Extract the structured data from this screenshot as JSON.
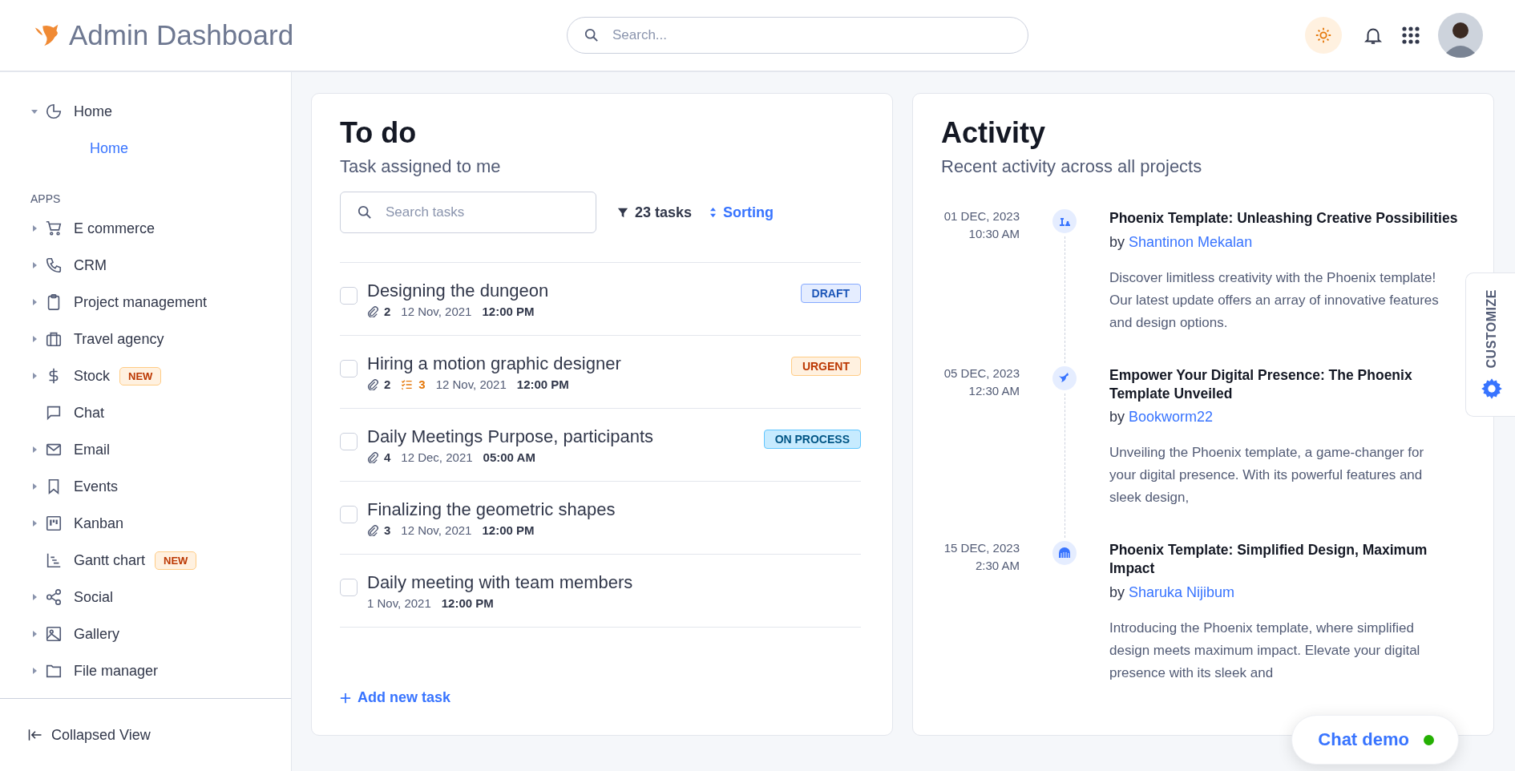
{
  "header": {
    "title": "Admin Dashboard",
    "search": {
      "placeholder": "Search..."
    }
  },
  "sidebar": {
    "groups": [
      {
        "label": "Home",
        "expanded": true,
        "children": [
          {
            "label": "Home",
            "selected": true
          }
        ]
      }
    ],
    "section_label": "APPS",
    "items": [
      {
        "label": "E commerce",
        "expandable": true
      },
      {
        "label": "CRM",
        "expandable": true
      },
      {
        "label": "Project management",
        "expandable": true
      },
      {
        "label": "Travel agency",
        "expandable": true
      },
      {
        "label": "Stock",
        "expandable": true,
        "badge": "NEW"
      },
      {
        "label": "Chat",
        "expandable": false
      },
      {
        "label": "Email",
        "expandable": true
      },
      {
        "label": "Events",
        "expandable": true
      },
      {
        "label": "Kanban",
        "expandable": true
      },
      {
        "label": "Gantt chart",
        "expandable": false,
        "badge": "NEW"
      },
      {
        "label": "Social",
        "expandable": true
      },
      {
        "label": "Gallery",
        "expandable": true
      },
      {
        "label": "File manager",
        "expandable": true
      }
    ],
    "footer": "Collapsed View"
  },
  "todo": {
    "title": "To do",
    "subtitle": "Task assigned to me",
    "search": {
      "placeholder": "Search tasks"
    },
    "count": "23 tasks",
    "sort": "Sorting",
    "tasks": [
      {
        "title": "Designing the dungeon",
        "checked": false,
        "attachments": "2",
        "date": "12 Nov, 2021",
        "time": "12:00 PM",
        "badge": {
          "text": "DRAFT",
          "kind": "draft"
        }
      },
      {
        "title": "Hiring a motion graphic designer",
        "checked": false,
        "attachments": "2",
        "subtasks": "3",
        "date": "12 Nov, 2021",
        "time": "12:00 PM",
        "badge": {
          "text": "URGENT",
          "kind": "urgent"
        }
      },
      {
        "title": "Daily Meetings Purpose, participants",
        "checked": false,
        "attachments": "4",
        "date": "12 Dec, 2021",
        "time": "05:00 AM",
        "badge": {
          "text": "ON PROCESS",
          "kind": "process"
        }
      },
      {
        "title": "Finalizing the geometric shapes",
        "checked": false,
        "attachments": "3",
        "date": "12 Nov, 2021",
        "time": "12:00 PM"
      },
      {
        "title": "Daily meeting with team members",
        "checked": false,
        "date": "1 Nov, 2021",
        "time": "12:00 PM"
      }
    ],
    "add": "Add new task"
  },
  "activity": {
    "title": "Activity",
    "subtitle": "Recent activity across all projects",
    "entries": [
      {
        "date": "01 DEC, 2023",
        "time": "10:30 AM",
        "title": "Phoenix Template: Unleashing Creative Possibilities",
        "prefix": "by",
        "author": "Shantinon Mekalan",
        "text": "Discover limitless creativity with the Phoenix template! Our latest update offers an array of innovative features and design options."
      },
      {
        "date": "05 DEC, 2023",
        "time": "12:30 AM",
        "title": "Empower Your Digital Presence: The Phoenix Template Unveiled",
        "prefix": "by",
        "author": "Bookworm22",
        "text": "Unveiling the Phoenix template, a game-changer for your digital presence. With its powerful features and sleek design,"
      },
      {
        "date": "15 DEC, 2023",
        "time": "2:30 AM",
        "title": "Phoenix Template: Simplified Design, Maximum Impact",
        "prefix": "by",
        "author": "Sharuka Nijibum",
        "text": "Introducing the Phoenix template, where simplified design meets maximum impact. Elevate your digital presence with its sleek and"
      }
    ]
  },
  "customize": "CUSTOMIZE",
  "chat": {
    "label": "Chat demo",
    "online": true
  }
}
